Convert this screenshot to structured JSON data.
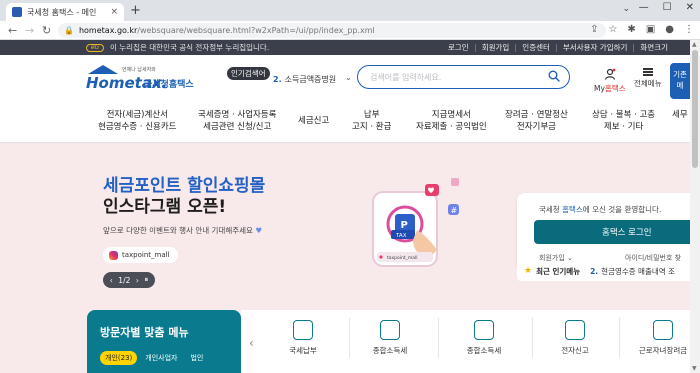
{
  "browser": {
    "tab_title": "국세청 홈택스 - 메인",
    "url_host": "hometax.go.kr",
    "url_path": "/websquare/websquare.html?w2xPath=/ui/pp/index_pp.xml",
    "new_tab_symbol": "+",
    "close_symbol": "×"
  },
  "topstrip": {
    "message": "이 누리집은 대한민국 공식 전자정부 누리집입니다.",
    "links": [
      "로그인",
      "회원가입",
      "인증센터",
      "부서사용자 가입하기",
      "화면크기"
    ]
  },
  "header": {
    "logo_slogan": "언제나 납세자와",
    "logo_text": "Hometax.",
    "logo_name": "국세청홈택스",
    "popular_badge": "인기검색어",
    "popular_rank": "2.",
    "popular_term": "소득금액증명원",
    "search_placeholder": "검색어를 입력하세요.",
    "myhome_prefix": "My",
    "myhome_suffix": "홈택스",
    "menu_all": "전체메뉴",
    "side_tab_l1": "기존",
    "side_tab_l2": "메"
  },
  "gnb": {
    "items": [
      {
        "l1": "전자(세금)계산서",
        "l2": "현금영수증 · 신용카드"
      },
      {
        "l1": "국세증명 · 사업자등록",
        "l2": "세금관련 신청/신고"
      },
      {
        "l1": "세금신고",
        "l2": ""
      },
      {
        "l1": "납부",
        "l2": "고지 · 환급"
      },
      {
        "l1": "지급명세서",
        "l2": "자료제출 · 공익법인"
      },
      {
        "l1": "장려금 · 연말정산",
        "l2": "전자기부금"
      },
      {
        "l1": "상담 · 불복 · 고충",
        "l2": "제보 · 기타"
      },
      {
        "l1": "세무",
        "l2": ""
      }
    ]
  },
  "promo": {
    "title_l1": "세금포인트 할인쇼핑몰",
    "title_l2": "인스타그램 오픈!",
    "subtitle": "앞으로 다양한 이벤트와 행사 안내 기대해주세요",
    "insta_handle": "taxpoint_mall",
    "pager_prev": "‹",
    "pager_text": "1/2",
    "pager_next": "›",
    "pager_pause": "⏸",
    "illus_badge": "TAX",
    "illus_handle": "taxpoint_mall"
  },
  "login": {
    "welcome_pre": "국세청 ",
    "welcome_hl": "홈택스",
    "welcome_post": "에 오신 것을 환영합니다.",
    "button": "홈택스 로그인",
    "signup": "회원가입",
    "find": "아이디/비밀번호 찾"
  },
  "popular_menu": {
    "label": "최근 인기메뉴",
    "rank": "2.",
    "item": "현금영수증 매출내역 조"
  },
  "visitor": {
    "title": "방문자별 맞춤 메뉴",
    "tabs": [
      "개인(23)",
      "개인사업자",
      "법인"
    ]
  },
  "quick_menu": {
    "items": [
      "국세납부",
      "종합소득세",
      "종합소득세",
      "전자신고",
      "근로자녀장려금"
    ]
  },
  "colors": {
    "primary_blue": "#1d5fb4",
    "teal": "#0a7b8e",
    "login_button": "#0a6b7c",
    "banner_bg": "#f8e9ea",
    "top_strip": "#3a3f4b"
  }
}
